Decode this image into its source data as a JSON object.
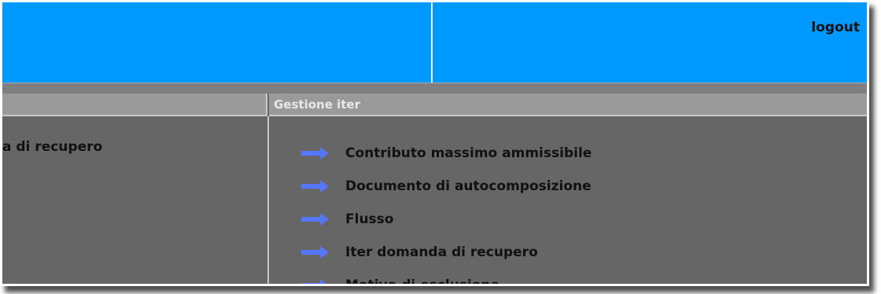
{
  "header": {
    "logout_label": "logout"
  },
  "left_column": {
    "header": "",
    "item_text": "a di recupero"
  },
  "right_column": {
    "header": "Gestione iter",
    "items": [
      {
        "label": "Contributo massimo ammissibile",
        "icon": "arrow-right-icon"
      },
      {
        "label": "Documento di autocomposizione",
        "icon": "arrow-right-icon"
      },
      {
        "label": "Flusso",
        "icon": "arrow-right-icon"
      },
      {
        "label": "Iter domanda di recupero",
        "icon": "arrow-right-icon"
      },
      {
        "label": "Motivo di esclusione",
        "icon": "arrow-right-icon"
      }
    ]
  },
  "colors": {
    "header_bg": "#0099ff",
    "content_bg": "#666666",
    "column_header_bg": "#9a9a9a",
    "arrow": "#5577ff"
  }
}
